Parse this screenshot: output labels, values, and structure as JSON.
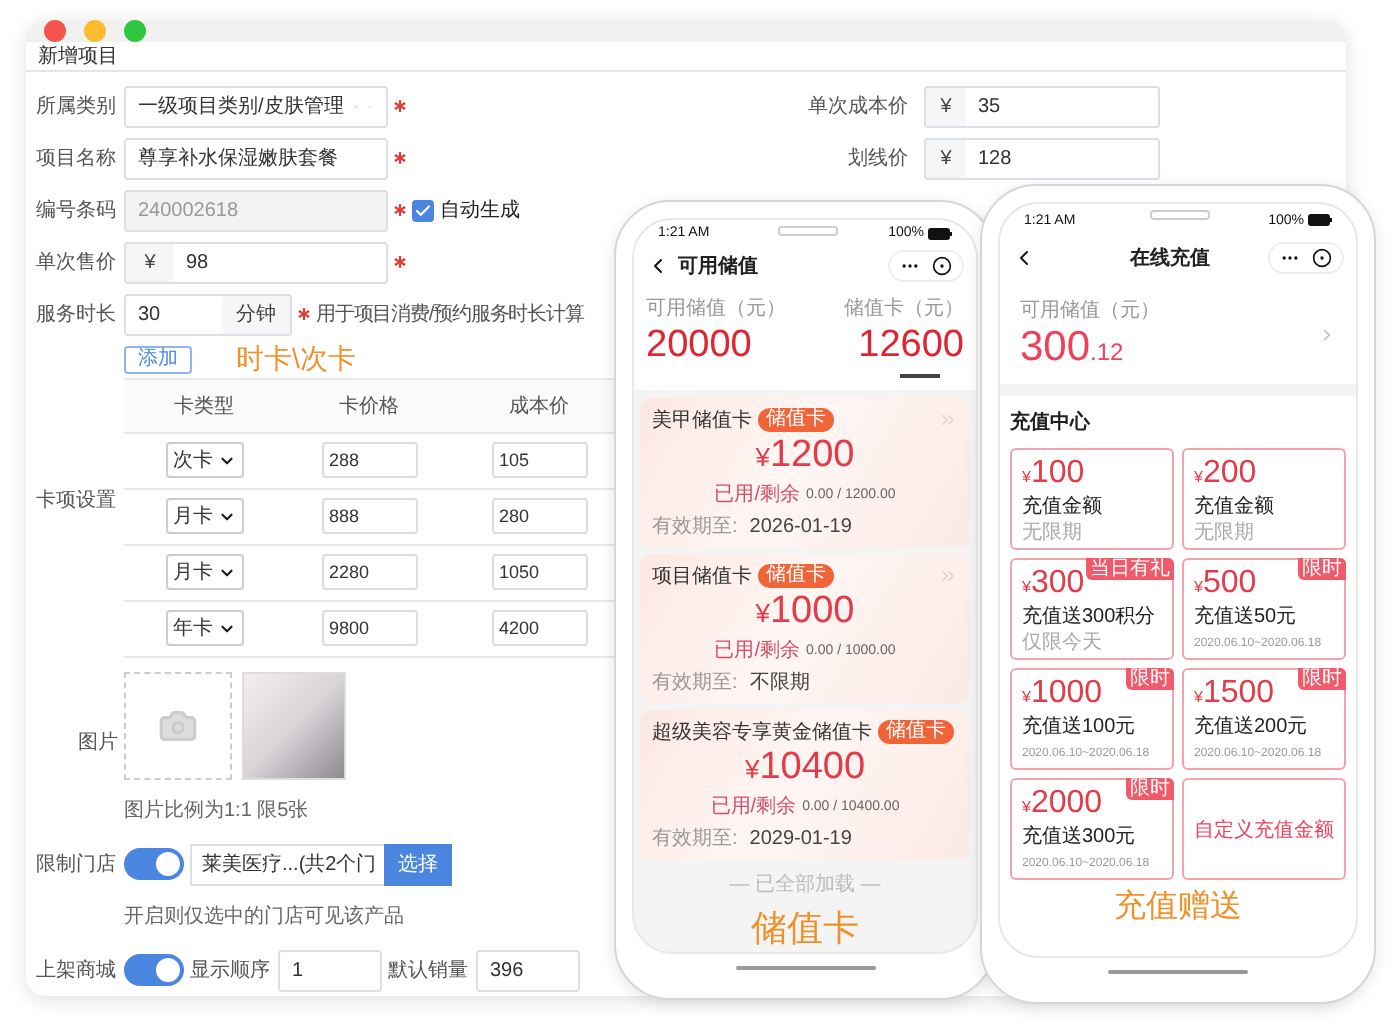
{
  "window": {
    "title": "新增项目"
  },
  "left_fields": [
    {
      "kind": "select",
      "label": "所属类别",
      "value": "一级项目类别/皮肤管理",
      "required": true
    },
    {
      "kind": "text",
      "label": "项目名称",
      "value": "尊享补水保湿嫩肤套餐",
      "required": true
    },
    {
      "kind": "code",
      "label": "编号条码",
      "value": "240002618",
      "required": true,
      "checkbox": {
        "label": "自动生成",
        "checked": true
      }
    },
    {
      "kind": "prefix",
      "label": "单次售价",
      "prefix": "¥",
      "value": "98",
      "required": true
    },
    {
      "kind": "suffix",
      "label": "服务时长",
      "value": "30",
      "suffix": "分钟",
      "required": true,
      "hint": "用于项目消费/预约服务时长计算"
    }
  ],
  "right_fields": [
    {
      "label": "单次成本价",
      "prefix": "¥",
      "value": "35"
    },
    {
      "label": "划线价",
      "prefix": "¥",
      "value": "128"
    }
  ],
  "card_settings": {
    "label": "卡项设置",
    "add_button": "添加",
    "caption": "时卡\\次卡",
    "columns": [
      "卡类型",
      "卡价格",
      "成本价"
    ],
    "rows": [
      {
        "type": "次卡",
        "price": "288",
        "cost": "105"
      },
      {
        "type": "月卡",
        "price": "888",
        "cost": "280"
      },
      {
        "type": "月卡",
        "price": "2280",
        "cost": "1050"
      },
      {
        "type": "年卡",
        "price": "9800",
        "cost": "4200"
      }
    ]
  },
  "images": {
    "label": "图片",
    "hint": "图片比例为1:1 限5张"
  },
  "store_limit": {
    "label": "限制门店",
    "on": true,
    "value": "莱美医疗...(共2个门",
    "button": "选择",
    "hint": "开启则仅选中的门店可见该产品"
  },
  "mall": {
    "label": "上架商城",
    "on": true,
    "order_label": "显示顺序",
    "order": "1",
    "sales_label": "默认销量",
    "sales": "396"
  },
  "phone_stored_value": {
    "time": "1:21 AM",
    "battery": "100%",
    "title": "可用储值",
    "stats": [
      {
        "label": "可用储值（元）",
        "value": "20000"
      },
      {
        "label": "储值卡（元）",
        "value": "12600"
      }
    ],
    "cards": [
      {
        "name": "美甲储值卡",
        "tag": "储值卡",
        "currency": "¥",
        "amount": "1200",
        "used_label": "已用/剩余",
        "used": "0.00 / 1200.00",
        "expiry_label": "有效期至:",
        "expiry": "2026-01-19"
      },
      {
        "name": "项目储值卡",
        "tag": "储值卡",
        "currency": "¥",
        "amount": "1000",
        "used_label": "已用/剩余",
        "used": "0.00 / 1000.00",
        "expiry_label": "有效期至:",
        "expiry": "不限期"
      },
      {
        "name": "超级美容专享黄金储值卡",
        "tag": "储值卡",
        "currency": "¥",
        "amount": "10400",
        "used_label": "已用/剩余",
        "used": "0.00 / 10400.00",
        "expiry_label": "有效期至:",
        "expiry": "2029-01-19"
      }
    ],
    "end_text": "— 已全部加载 —",
    "caption": "储值卡"
  },
  "phone_recharge": {
    "time": "1:21 AM",
    "battery": "100%",
    "title": "在线充值",
    "balance_label": "可用储值（元）",
    "balance_int": "300",
    "balance_dec": ".12",
    "section": "充值中心",
    "options": [
      {
        "kind": "amount",
        "currency": "¥",
        "amount": "100",
        "desc": "充值金额",
        "note": "无限期"
      },
      {
        "kind": "amount",
        "currency": "¥",
        "amount": "200",
        "desc": "充值金额",
        "note": "无限期"
      },
      {
        "kind": "amount",
        "currency": "¥",
        "amount": "300",
        "desc": "充值送300积分",
        "note": "仅限今天",
        "badge": "当日有礼"
      },
      {
        "kind": "amount",
        "currency": "¥",
        "amount": "500",
        "desc": "充值送50元",
        "period": "2020.06.10~2020.06.18",
        "badge": "限时"
      },
      {
        "kind": "amount",
        "currency": "¥",
        "amount": "1000",
        "desc": "充值送100元",
        "period": "2020.06.10~2020.06.18",
        "badge": "限时"
      },
      {
        "kind": "amount",
        "currency": "¥",
        "amount": "1500",
        "desc": "充值送200元",
        "period": "2020.06.10~2020.06.18",
        "badge": "限时"
      },
      {
        "kind": "amount",
        "currency": "¥",
        "amount": "2000",
        "desc": "充值送300元",
        "period": "2020.06.10~2020.06.18",
        "badge": "限时"
      },
      {
        "kind": "custom",
        "label": "自定义充值金额"
      }
    ],
    "caption": "充值赠送"
  }
}
